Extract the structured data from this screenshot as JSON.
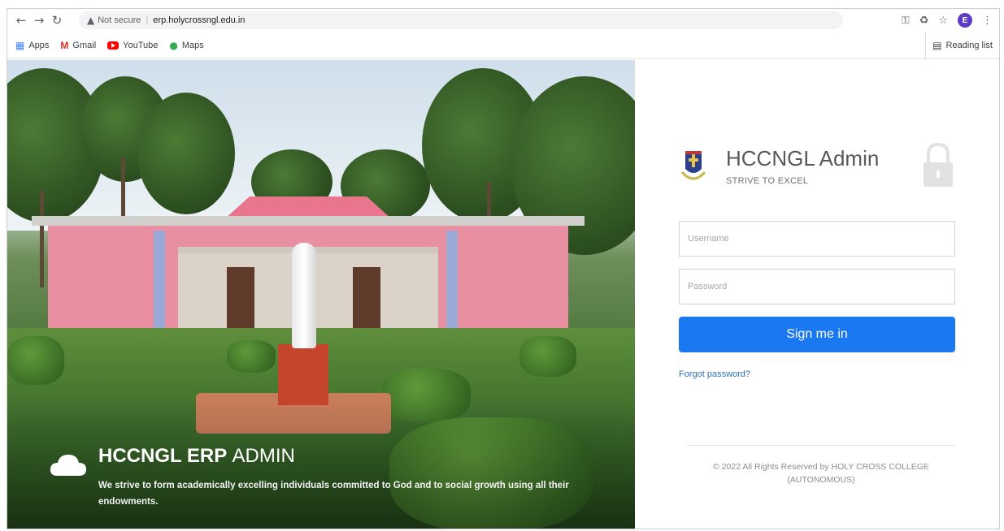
{
  "browser": {
    "security_label": "Not secure",
    "url": "erp.holycrossngl.edu.in",
    "avatar_letter": "E",
    "icons": [
      "back-arrow",
      "forward-arrow",
      "reload",
      "warning",
      "key",
      "extension",
      "star",
      "menu-dots"
    ]
  },
  "bookmarks": {
    "items": [
      {
        "label": "Apps",
        "icon": "apps-grid"
      },
      {
        "label": "Gmail",
        "icon": "gmail"
      },
      {
        "label": "YouTube",
        "icon": "youtube"
      },
      {
        "label": "Maps",
        "icon": "maps-pin"
      }
    ],
    "reading_list": "Reading list"
  },
  "hero": {
    "title_bold": "HCCNGL ERP",
    "title_light": "ADMIN",
    "description": "We strive to form academically excelling individuals committed to God and to social growth using all their endowments."
  },
  "login": {
    "title": "HCCNGL Admin",
    "tagline": "STRIVE TO EXCEL",
    "username_placeholder": "Username",
    "password_placeholder": "Password",
    "signin_label": "Sign me in",
    "forgot_label": "Forgot password?",
    "footer": "© 2022 All Rights Reserved by HOLY CROSS COLLEGE (AUTONOMOUS)"
  },
  "colors": {
    "accent": "#1a78f0",
    "link": "#2f6fb3",
    "avatar": "#5b3cc4"
  }
}
